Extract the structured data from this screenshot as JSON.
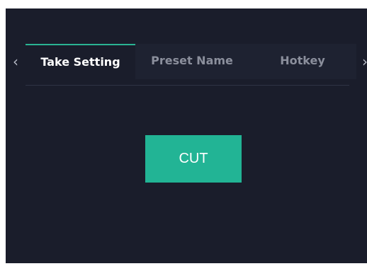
{
  "tabs": {
    "prev_arrow": "‹",
    "next_arrow": "›",
    "items": [
      {
        "label": "Take Setting",
        "active": true
      },
      {
        "label": "Preset Name",
        "active": false
      },
      {
        "label": "Hotkey",
        "active": false
      }
    ]
  },
  "content": {
    "cut_label": "CUT"
  },
  "colors": {
    "panel_background": "#1a1d2b",
    "inactive_tab_background": "#1e2231",
    "accent": "#2ab393",
    "button": "#22b495",
    "active_text": "#ffffff",
    "inactive_text": "#8b8f9c"
  }
}
